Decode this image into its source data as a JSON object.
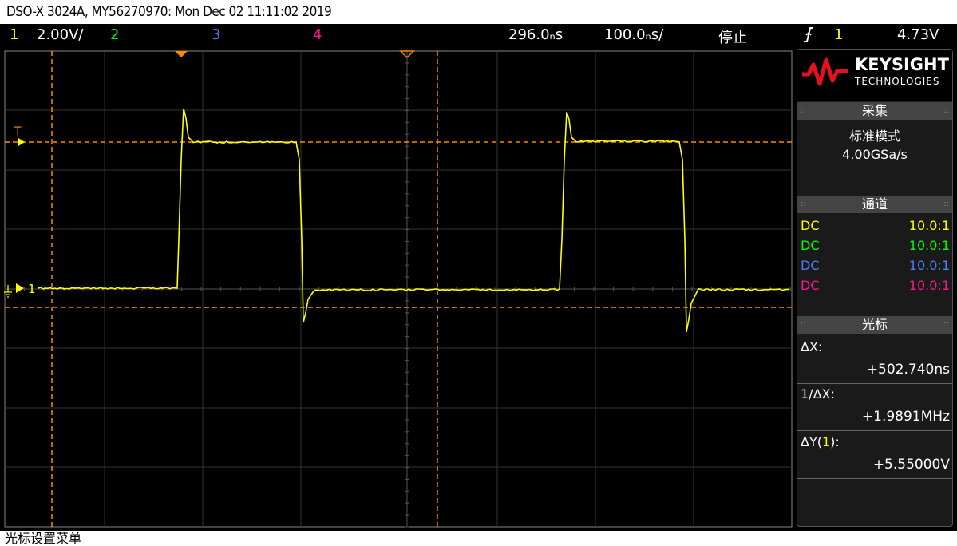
{
  "title": "DSO-X 3024A, MY56270970: Mon Dec 02 11:11:02 2019",
  "status": {
    "ch1_num": "1",
    "ch1_scale": "2.00V/",
    "ch2_num": "2",
    "ch3_num": "3",
    "ch4_num": "4",
    "time_delay": "296.0ₙs",
    "time_scale": "100.0ₙs/",
    "run_state": "停止",
    "trigger_icon": "rising-edge",
    "trigger_source": "1",
    "trigger_level": "4.73V"
  },
  "colors": {
    "ch1": "#ffff00",
    "ch2": "#00ff00",
    "ch3": "#4f7bff",
    "ch4": "#ff1493",
    "cursor": "#ff8c00"
  },
  "markers": {
    "trig_marker_label": "T",
    "ch1_ground_label": "1"
  },
  "sidebar": {
    "brand": "KEYSIGHT",
    "brand_sub": "TECHNOLOGIES",
    "acquire": {
      "header": "采集",
      "mode": "标准模式",
      "rate": "4.00GSa/s"
    },
    "channels": {
      "header": "通道",
      "rows": [
        {
          "coupling": "DC",
          "probe": "10.0:1"
        },
        {
          "coupling": "DC",
          "probe": "10.0:1"
        },
        {
          "coupling": "DC",
          "probe": "10.0:1"
        },
        {
          "coupling": "DC",
          "probe": "10.0:1"
        }
      ]
    },
    "cursors": {
      "header": "光标",
      "dx_label": "ΔX:",
      "dx_value": "+502.740ns",
      "inv_dx_label": "1/ΔX:",
      "inv_dx_value": "+1.9891MHz",
      "dy_label_prefix": "ΔY(",
      "dy_label_ch": "1",
      "dy_label_suffix": "):",
      "dy_value": "+5.55000V"
    }
  },
  "footer": "光标设置菜单"
}
